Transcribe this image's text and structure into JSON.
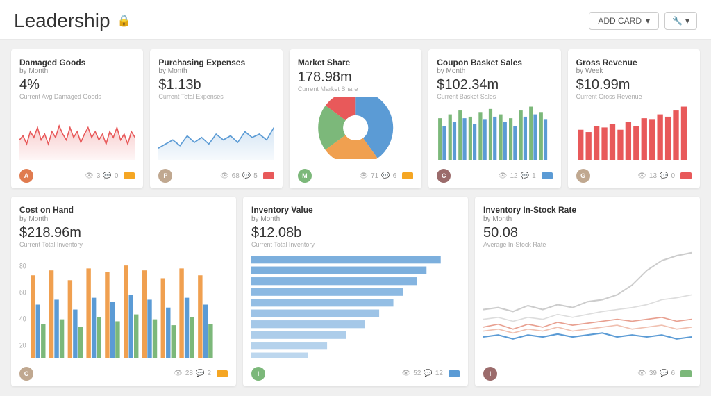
{
  "header": {
    "title": "Leadership",
    "add_card_label": "ADD CARD",
    "wrench_label": "⚙"
  },
  "cards": {
    "row1": [
      {
        "id": "damaged-goods",
        "title": "Damaged Goods",
        "subtitle": "by Month",
        "value": "4%",
        "desc": "Current Avg Damaged Goods",
        "chart_type": "line_red",
        "footer_avatar_color": "#e07b4f",
        "footer_avatar_letter": "A",
        "footer_views": "3",
        "footer_comments": "0",
        "footer_badge_color": "#f5a623"
      },
      {
        "id": "purchasing-expenses",
        "title": "Purchasing Expenses",
        "subtitle": "by Month",
        "value": "$1.13b",
        "desc": "Current Total Expenses",
        "chart_type": "line_blue",
        "footer_avatar_color": "#c0a890",
        "footer_avatar_letter": "P",
        "footer_views": "68",
        "footer_comments": "5",
        "footer_badge_color": "#e8595a"
      },
      {
        "id": "market-share",
        "title": "Market Share",
        "subtitle": "",
        "value": "178.98m",
        "desc": "Current Market Share",
        "chart_type": "pie",
        "footer_avatar_color": "#7cb87a",
        "footer_avatar_letter": "M",
        "footer_views": "71",
        "footer_comments": "6",
        "footer_badge_color": "#f5a623"
      },
      {
        "id": "coupon-basket-sales",
        "title": "Coupon Basket Sales",
        "subtitle": "by Month",
        "value": "$102.34m",
        "desc": "Current Basket Sales",
        "chart_type": "bar_grouped_green",
        "footer_avatar_color": "#9b6b6b",
        "footer_avatar_letter": "C",
        "footer_views": "12",
        "footer_comments": "1",
        "footer_badge_color": "#5b9bd5"
      },
      {
        "id": "gross-revenue",
        "title": "Gross Revenue",
        "subtitle": "by Week",
        "value": "$10.99m",
        "desc": "Current Gross Revenue",
        "chart_type": "bar_red",
        "footer_avatar_color": "#c0a890",
        "footer_avatar_letter": "G",
        "footer_views": "13",
        "footer_comments": "0",
        "footer_badge_color": "#e8595a"
      }
    ],
    "row2": [
      {
        "id": "cost-on-hand",
        "title": "Cost on Hand",
        "subtitle": "by Month",
        "value": "$218.96m",
        "desc": "Current Total Inventory",
        "chart_type": "bar_multi",
        "footer_avatar_color": "#c0a890",
        "footer_avatar_letter": "C",
        "footer_views": "28",
        "footer_comments": "2",
        "footer_badge_color": "#f5a623"
      },
      {
        "id": "inventory-value",
        "title": "Inventory Value",
        "subtitle": "by Month",
        "value": "$12.08b",
        "desc": "Current Total Inventory",
        "chart_type": "bar_horizontal",
        "footer_avatar_color": "#7cb87a",
        "footer_avatar_letter": "I",
        "footer_views": "52",
        "footer_comments": "12",
        "footer_badge_color": "#5b9bd5"
      },
      {
        "id": "inventory-instock",
        "title": "Inventory In-Stock Rate",
        "subtitle": "by Month",
        "value": "50.08",
        "desc": "Average In-Stock Rate",
        "chart_type": "line_multi",
        "footer_avatar_color": "#9b6b6b",
        "footer_avatar_letter": "I",
        "footer_views": "39",
        "footer_comments": "6",
        "footer_badge_color": "#7cb87a"
      }
    ]
  }
}
